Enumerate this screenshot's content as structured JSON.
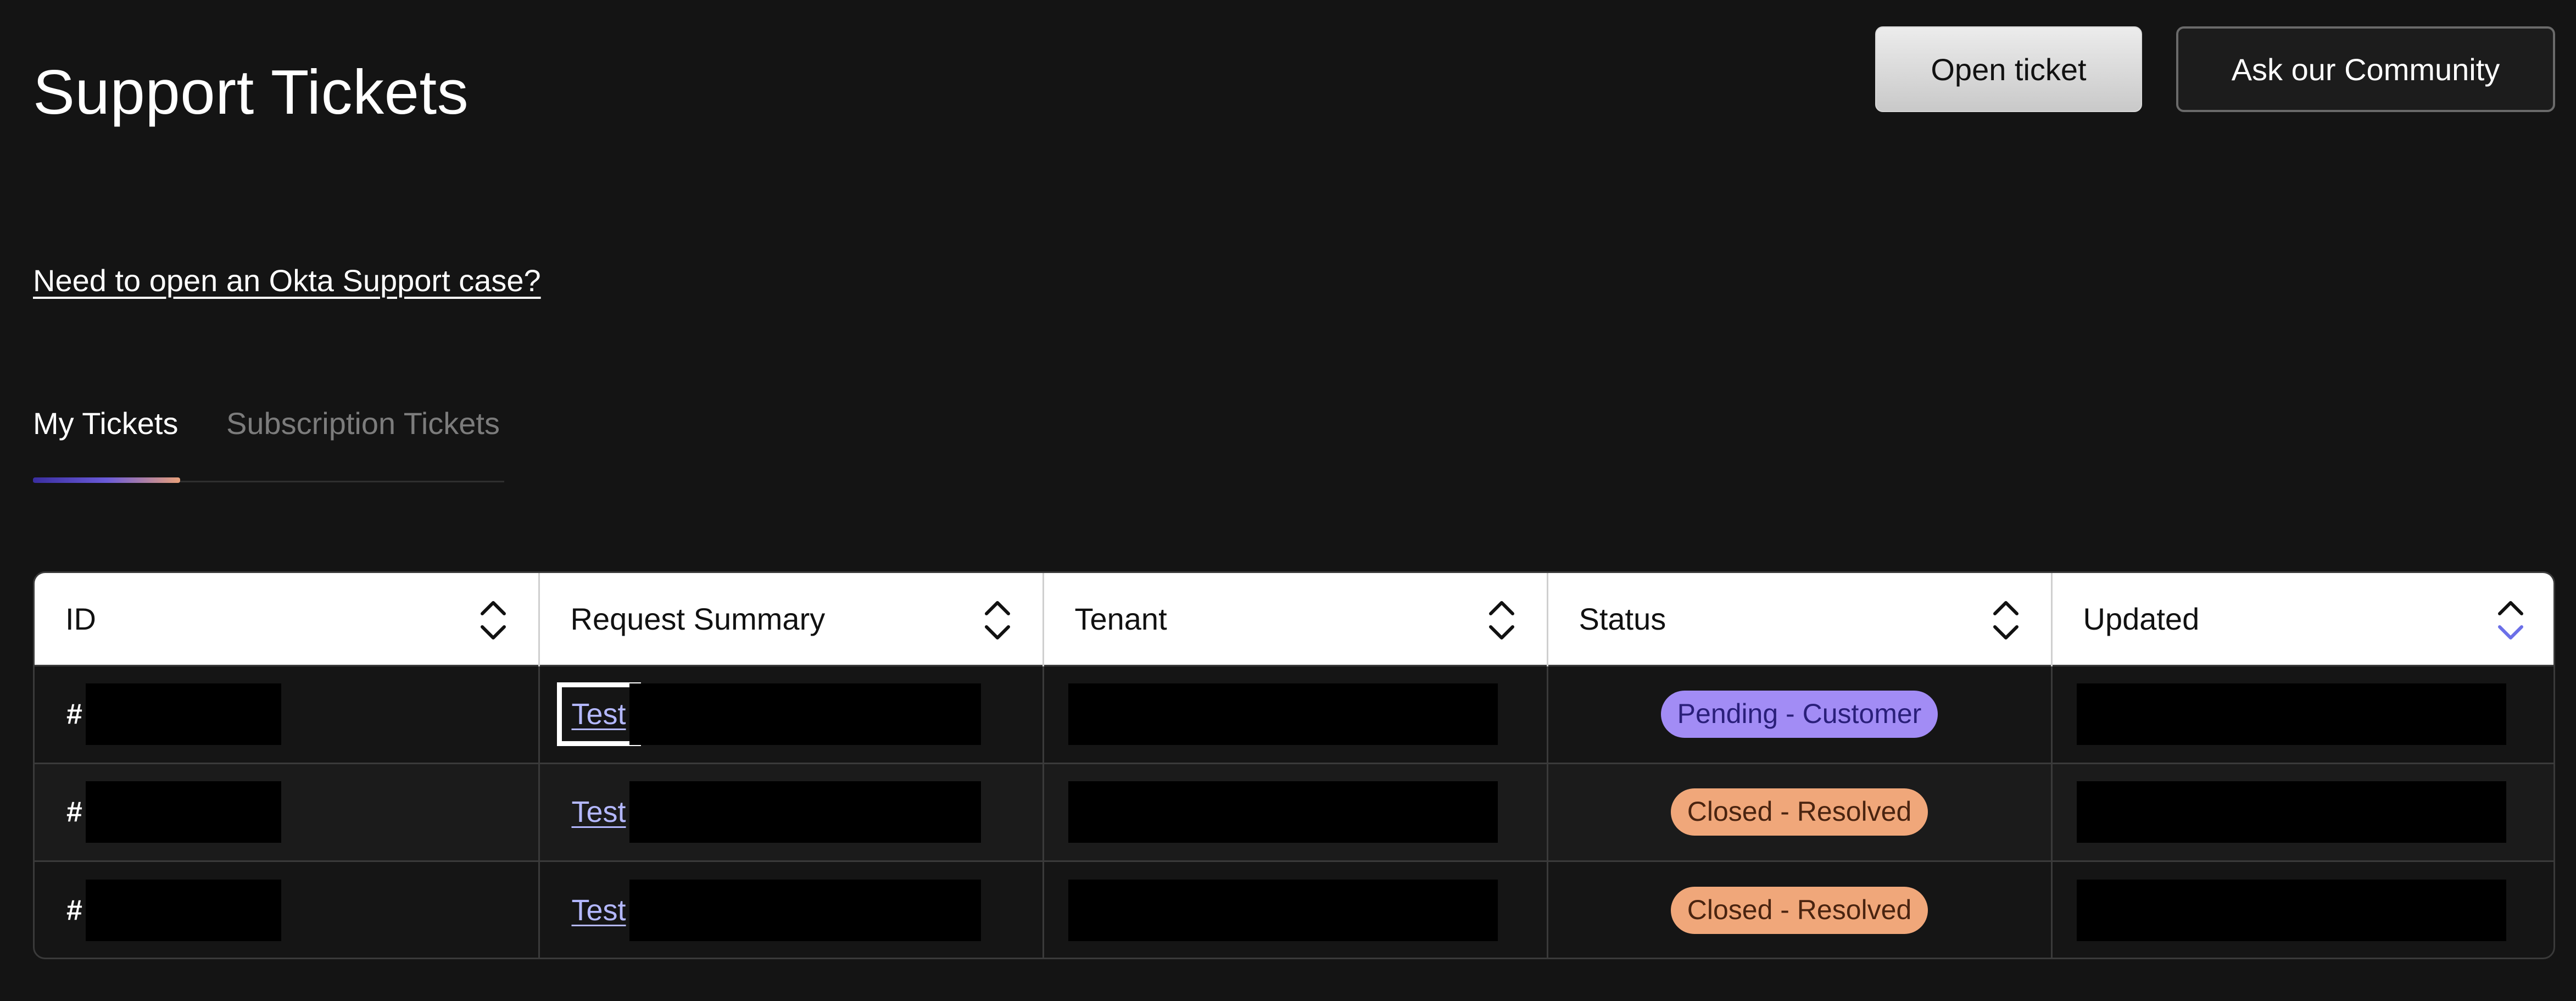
{
  "page": {
    "title": "Support Tickets",
    "okta_link": "Need to open an Okta Support case?"
  },
  "actions": {
    "open_ticket": "Open ticket",
    "ask_community": "Ask our Community"
  },
  "tabs": [
    {
      "label": "My Tickets",
      "active": true
    },
    {
      "label": "Subscription Tickets",
      "active": false
    }
  ],
  "table": {
    "columns": [
      "ID",
      "Request Summary",
      "Tenant",
      "Status",
      "Updated"
    ],
    "sorted_column": "Updated",
    "rows": [
      {
        "id_prefix": "#",
        "summary": "Test",
        "status": "Pending - Customer",
        "status_kind": "pending"
      },
      {
        "id_prefix": "#",
        "summary": "Test",
        "status": "Closed - Resolved",
        "status_kind": "closed"
      },
      {
        "id_prefix": "#",
        "summary": "Test",
        "status": "Closed - Resolved",
        "status_kind": "closed"
      }
    ]
  },
  "colors": {
    "background": "#141414",
    "accent_purple": "#a28cf5",
    "accent_orange": "#f0a77a",
    "link": "#b4b8ff"
  }
}
